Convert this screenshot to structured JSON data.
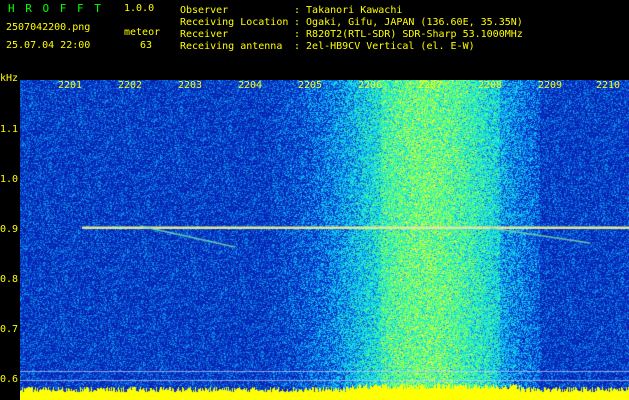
{
  "app": {
    "title": "H R O F F T",
    "version": "1.0.0"
  },
  "file": {
    "name": "2507042200.png",
    "datetime": "25.07.04 22:00"
  },
  "detection": {
    "label": "meteor",
    "count": "63"
  },
  "station": {
    "labels": [
      "Observer",
      "Receiving Location",
      "Receiver",
      "Receiving antenna"
    ],
    "values": [
      ": Takanori Kawachi",
      ": Ogaki, Gifu, JAPAN (136.60E, 35.35N)",
      ": R820T2(RTL-SDR) SDR-Sharp 53.1000MHz",
      ": 2el-HB9CV Vertical (el. E-W)"
    ]
  },
  "axis": {
    "y_unit": "kHz",
    "y_ticks": [
      "1.1",
      "1.0",
      "0.9",
      "0.8",
      "0.7",
      "0.6"
    ],
    "x_ticks": [
      "2201",
      "2202",
      "2203",
      "2204",
      "2205",
      "2206",
      "2207",
      "2208",
      "2209",
      "2210"
    ]
  },
  "colors": {
    "background": "#000000",
    "header_text": "#ffff00",
    "info_text": "#ffffff",
    "title_text": "#00ff00",
    "spectrogram_base": "#0a1a9c",
    "carrier_line": "#e0e060"
  }
}
